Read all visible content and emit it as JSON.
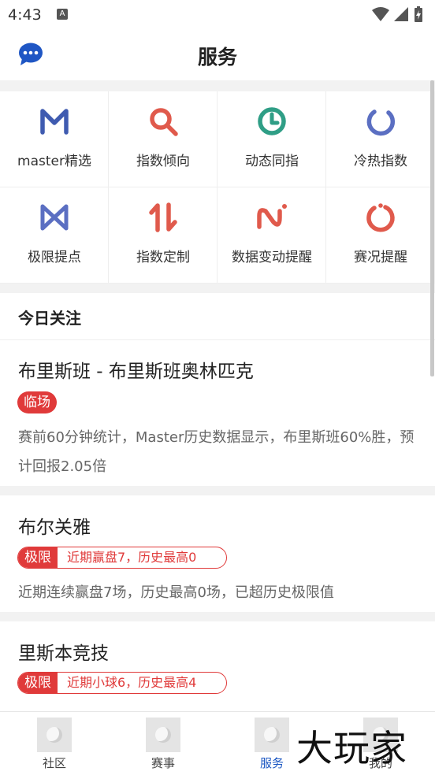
{
  "status": {
    "time": "4:43",
    "a_badge": "A"
  },
  "header": {
    "title": "服务"
  },
  "services": [
    {
      "label": "master精选",
      "icon": "m-logo-icon",
      "color": "#3f5bb0"
    },
    {
      "label": "指数倾向",
      "icon": "search-icon",
      "color": "#e05a4c"
    },
    {
      "label": "动态同指",
      "icon": "clock-icon",
      "color": "#2f9e86"
    },
    {
      "label": "冷热指数",
      "icon": "ring-icon",
      "color": "#5b6fc2"
    },
    {
      "label": "极限提点",
      "icon": "bowtie-icon",
      "color": "#5b6fc2"
    },
    {
      "label": "指数定制",
      "icon": "up-down-arrows-icon",
      "color": "#e05a4c"
    },
    {
      "label": "数据变动提醒",
      "icon": "wave-icon",
      "color": "#e05a4c"
    },
    {
      "label": "赛况提醒",
      "icon": "power-ring-icon",
      "color": "#e05a4c"
    }
  ],
  "today": {
    "title": "今日关注",
    "items": [
      {
        "title": "布里斯班 - 布里斯班奥林匹克",
        "tag": "临场",
        "desc": "赛前60分钟统计，Master历史数据显示，布里斯班60%胜，预计回报2.05倍"
      },
      {
        "title": "布尔关雅",
        "tag": "极限",
        "tag_detail": "近期赢盘7，历史最高0",
        "desc": "近期连续赢盘7场，历史最高0场，已超历史极限值"
      },
      {
        "title": "里斯本竞技",
        "tag": "极限",
        "tag_detail": "近期小球6，历史最高4"
      }
    ]
  },
  "tabs": [
    {
      "label": "社区",
      "active": false
    },
    {
      "label": "赛事",
      "active": false
    },
    {
      "label": "服务",
      "active": true
    },
    {
      "label": "我的",
      "active": false
    }
  ],
  "watermark": "大玩家",
  "colors": {
    "accent_red": "#e03a3a",
    "active_tab": "#1a56c2"
  }
}
